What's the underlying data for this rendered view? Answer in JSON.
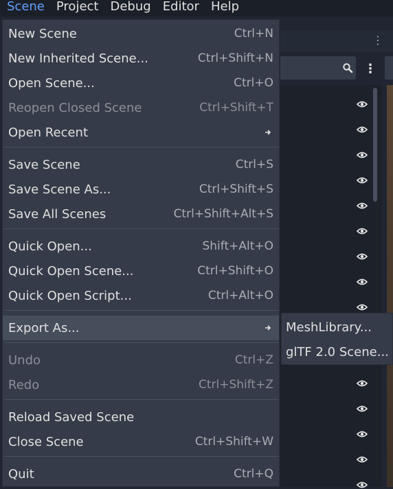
{
  "menubar": {
    "items": [
      {
        "label": "Scene",
        "active": true
      },
      {
        "label": "Project"
      },
      {
        "label": "Debug"
      },
      {
        "label": "Editor"
      },
      {
        "label": "Help"
      }
    ]
  },
  "scene_menu": {
    "items": [
      {
        "label": "New Scene",
        "shortcut": "Ctrl+N"
      },
      {
        "label": "New Inherited Scene...",
        "shortcut": "Ctrl+Shift+N"
      },
      {
        "label": "Open Scene...",
        "shortcut": "Ctrl+O"
      },
      {
        "label": "Reopen Closed Scene",
        "shortcut": "Ctrl+Shift+T",
        "disabled": true
      },
      {
        "label": "Open Recent",
        "submenu": true
      },
      {
        "label": "Save Scene",
        "shortcut": "Ctrl+S"
      },
      {
        "label": "Save Scene As...",
        "shortcut": "Ctrl+Shift+S"
      },
      {
        "label": "Save All Scenes",
        "shortcut": "Ctrl+Shift+Alt+S"
      },
      {
        "label": "Quick Open...",
        "shortcut": "Shift+Alt+O"
      },
      {
        "label": "Quick Open Scene...",
        "shortcut": "Ctrl+Shift+O"
      },
      {
        "label": "Quick Open Script...",
        "shortcut": "Ctrl+Alt+O"
      },
      {
        "label": "Export As...",
        "submenu": true,
        "highlighted": true
      },
      {
        "label": "Undo",
        "shortcut": "Ctrl+Z",
        "disabled": true
      },
      {
        "label": "Redo",
        "shortcut": "Ctrl+Shift+Z",
        "disabled": true
      },
      {
        "label": "Reload Saved Scene"
      },
      {
        "label": "Close Scene",
        "shortcut": "Ctrl+Shift+W"
      },
      {
        "label": "Quit",
        "shortcut": "Ctrl+Q"
      }
    ]
  },
  "export_submenu": {
    "items": [
      {
        "label": "MeshLibrary..."
      },
      {
        "label": "glTF 2.0 Scene..."
      }
    ]
  },
  "icons": {
    "submenu_arrow": "arrow-right-icon",
    "search": "search-icon",
    "kebab": "kebab-menu-icon",
    "visibility": "eye-icon"
  },
  "colors": {
    "accent": "#63a2ff",
    "menu_bg": "#353b48",
    "menubar_bg": "#1b1f27"
  }
}
